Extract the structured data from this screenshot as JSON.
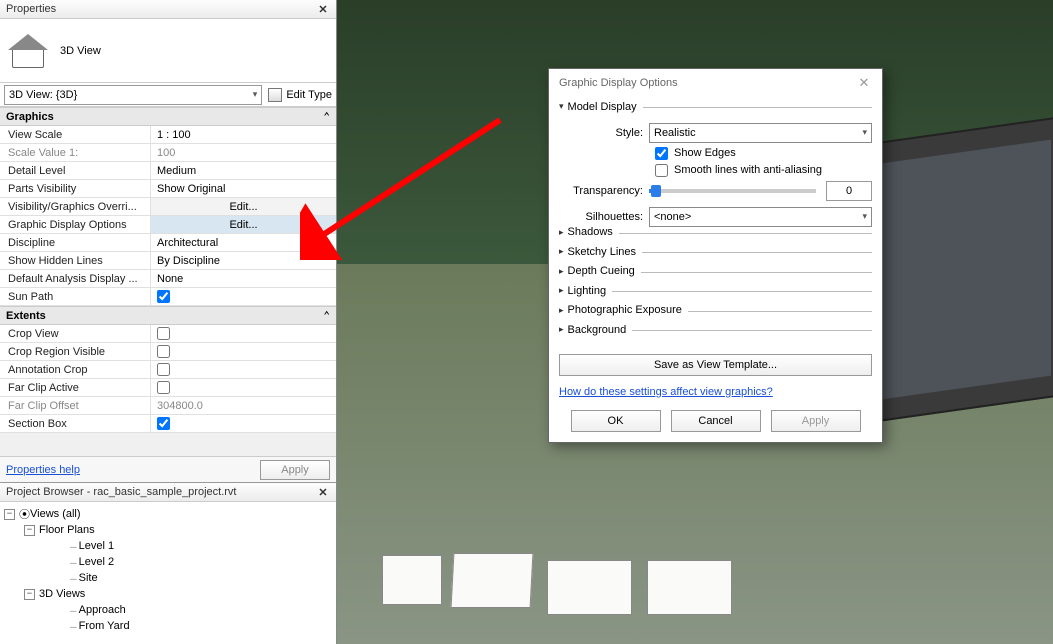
{
  "properties": {
    "title": "Properties",
    "type_label": "3D View",
    "view_combo": "3D View: {3D}",
    "edit_type": "Edit Type",
    "sections": {
      "graphics": "Graphics",
      "extents": "Extents"
    },
    "graphics_rows": {
      "view_scale": {
        "k": "View Scale",
        "v": "1 : 100"
      },
      "scale_value": {
        "k": "Scale Value    1:",
        "v": "100"
      },
      "detail_level": {
        "k": "Detail Level",
        "v": "Medium"
      },
      "parts_visibility": {
        "k": "Parts Visibility",
        "v": "Show Original"
      },
      "vis_graphics": {
        "k": "Visibility/Graphics Overri...",
        "v": "Edit..."
      },
      "graphic_display": {
        "k": "Graphic Display Options",
        "v": "Edit..."
      },
      "discipline": {
        "k": "Discipline",
        "v": "Architectural"
      },
      "show_hidden": {
        "k": "Show Hidden Lines",
        "v": "By Discipline"
      },
      "default_analysis": {
        "k": "Default Analysis Display ...",
        "v": "None"
      },
      "sun_path": {
        "k": "Sun Path",
        "checked": true
      }
    },
    "extents_rows": {
      "crop_view": {
        "k": "Crop View",
        "checked": false
      },
      "crop_region": {
        "k": "Crop Region Visible",
        "checked": false
      },
      "annotation_crop": {
        "k": "Annotation Crop",
        "checked": false
      },
      "far_clip_active": {
        "k": "Far Clip Active",
        "checked": false
      },
      "far_clip_offset": {
        "k": "Far Clip Offset",
        "v": "304800.0"
      },
      "section_box": {
        "k": "Section Box",
        "checked": true
      }
    },
    "help": "Properties help",
    "apply": "Apply"
  },
  "browser": {
    "title": "Project Browser - rac_basic_sample_project.rvt",
    "root": "Views (all)",
    "floor_plans": "Floor Plans",
    "level1": "Level 1",
    "level2": "Level 2",
    "site": "Site",
    "three_d": "3D Views",
    "approach": "Approach",
    "from_yard": "From Yard"
  },
  "dialog": {
    "title": "Graphic Display Options",
    "model_display": "Model Display",
    "style_label": "Style:",
    "style_value": "Realistic",
    "show_edges": "Show Edges",
    "smooth_lines": "Smooth lines with anti-aliasing",
    "transparency_label": "Transparency:",
    "transparency_value": "0",
    "silhouettes_label": "Silhouettes:",
    "silhouettes_value": "<none>",
    "groups": {
      "shadows": "Shadows",
      "sketchy": "Sketchy Lines",
      "depth": "Depth Cueing",
      "lighting": "Lighting",
      "photo": "Photographic Exposure",
      "background": "Background"
    },
    "save_template": "Save as View Template...",
    "help_link": "How do these settings affect view graphics?",
    "ok": "OK",
    "cancel": "Cancel",
    "apply": "Apply"
  }
}
